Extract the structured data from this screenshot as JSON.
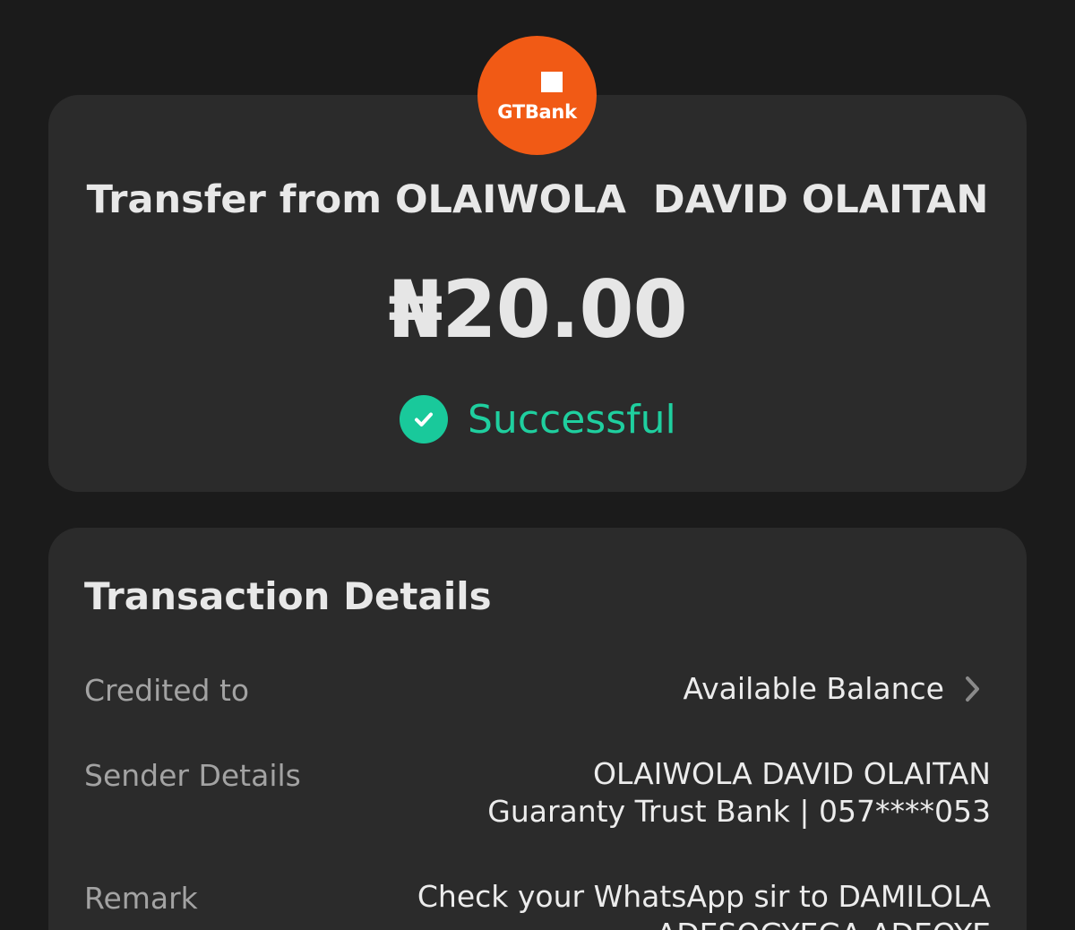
{
  "logo": {
    "text": "GTBank",
    "color": "#f15a15"
  },
  "summary": {
    "title": "Transfer from OLAIWOLA  DAVID OLAITAN",
    "amount": "₦20.00",
    "status": "Successful",
    "status_color": "#1fcf9f",
    "status_icon": "check-circle-icon"
  },
  "details": {
    "title": "Transaction Details",
    "credited_to": {
      "label": "Credited to",
      "value": "Available Balance",
      "icon": "chevron-right-icon"
    },
    "sender": {
      "label": "Sender Details",
      "name": "OLAIWOLA DAVID OLAITAN",
      "bank": "Guaranty Trust Bank | 057****053"
    },
    "remark": {
      "label": "Remark",
      "line1": "Check your WhatsApp sir to DAMILOLA",
      "line2": "ADESOGYEGA ADEOYE"
    }
  }
}
